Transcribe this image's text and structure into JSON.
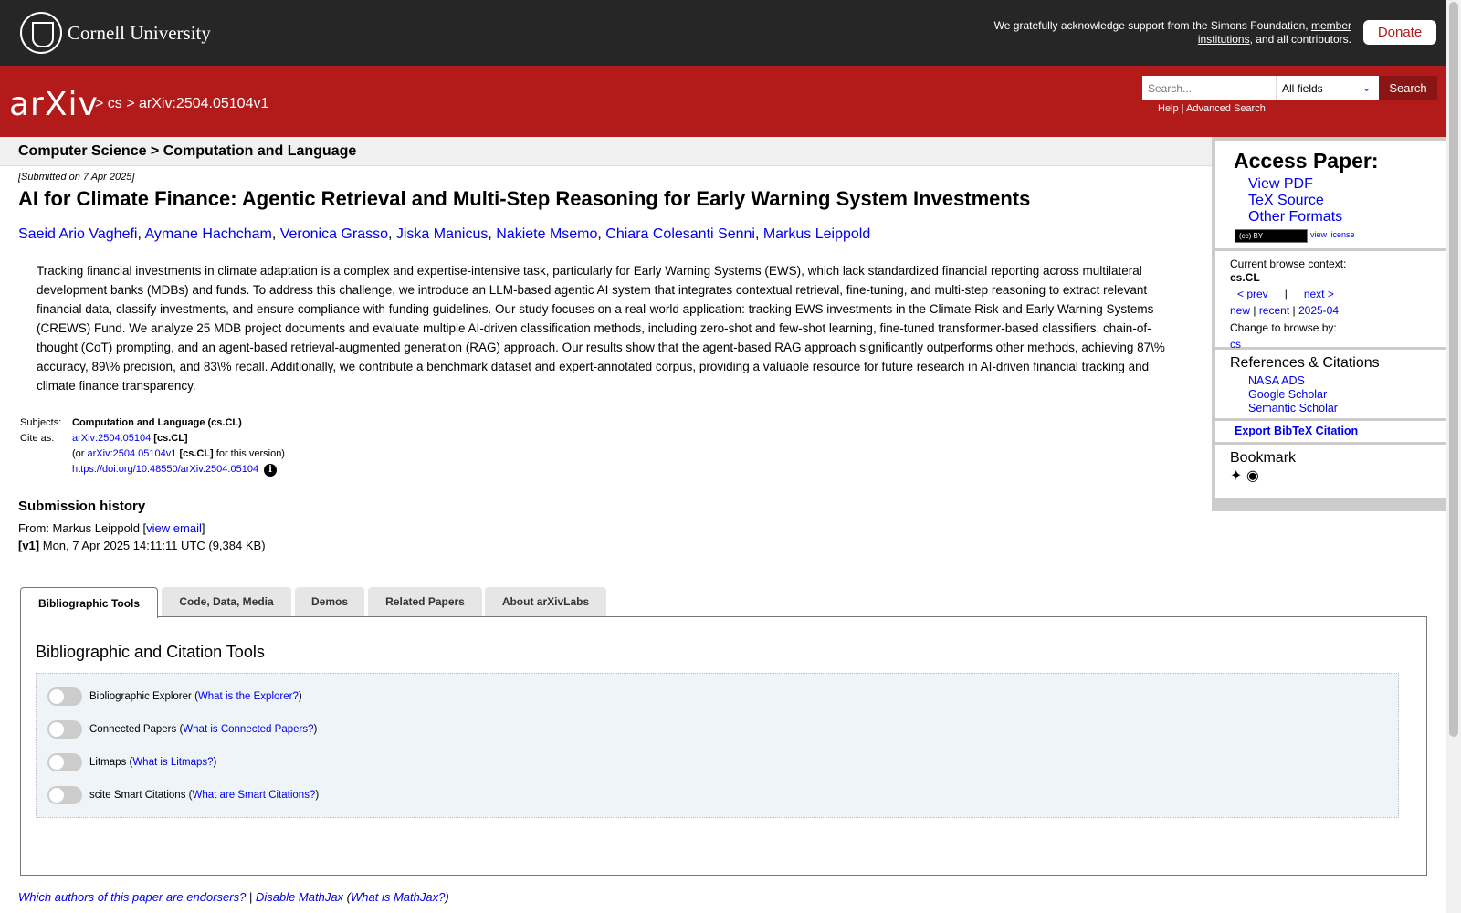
{
  "topbar": {
    "university": "Cornell University",
    "ack_line1": "We gratefully acknowledge support from the Simons Foundation,",
    "ack_link1": "member",
    "ack_link2": "institutions",
    "ack_tail": ", and all contributors.",
    "donate": "Donate"
  },
  "header": {
    "logo": "arXiv",
    "crumb_cs": "cs",
    "crumb_id": "arXiv:2504.05104v1",
    "search_placeholder": "Search...",
    "field_selected": "All fields",
    "search_button": "Search",
    "help": "Help",
    "advanced": "Advanced Search"
  },
  "subhead": "Computer Science > Computation and Language",
  "paper": {
    "submitted": "[Submitted on 7 Apr 2025]",
    "title": "AI for Climate Finance: Agentic Retrieval and Multi-Step Reasoning for Early Warning System Investments",
    "authors": [
      "Saeid Ario Vaghefi",
      "Aymane Hachcham",
      "Veronica Grasso",
      "Jiska Manicus",
      "Nakiete Msemo",
      "Chiara Colesanti Senni",
      "Markus Leippold"
    ],
    "abstract": "Tracking financial investments in climate adaptation is a complex and expertise-intensive task, particularly for Early Warning Systems (EWS), which lack standardized financial reporting across multilateral development banks (MDBs) and funds. To address this challenge, we introduce an LLM-based agentic AI system that integrates contextual retrieval, fine-tuning, and multi-step reasoning to extract relevant financial data, classify investments, and ensure compliance with funding guidelines. Our study focuses on a real-world application: tracking EWS investments in the Climate Risk and Early Warning Systems (CREWS) Fund. We analyze 25 MDB project documents and evaluate multiple AI-driven classification methods, including zero-shot and few-shot learning, fine-tuned transformer-based classifiers, chain-of-thought (CoT) prompting, and an agent-based retrieval-augmented generation (RAG) approach. Our results show that the agent-based RAG approach significantly outperforms other methods, achieving 87\\% accuracy, 89\\% precision, and 83\\% recall. Additionally, we contribute a benchmark dataset and expert-annotated corpus, providing a valuable resource for future research in AI-driven financial tracking and climate finance transparency.",
    "subjects_label": "Subjects:",
    "subjects": "Computation and Language (cs.CL)",
    "cite_label": "Cite as:",
    "cite_id": "arXiv:2504.05104",
    "cite_tag": "[cs.CL]",
    "cite_or": "(or",
    "cite_version": "arXiv:2504.05104v1",
    "cite_tag2": "[cs.CL]",
    "cite_for": "for this version)",
    "doi": "https://doi.org/10.48550/arXiv.2504.05104",
    "history_heading": "Submission history",
    "from_label": "From: Markus Leippold [",
    "view_email": "view email",
    "from_close": "]",
    "v1_label": "[v1]",
    "v1_text": "Mon, 7 Apr 2025 14:11:11 UTC (9,384 KB)"
  },
  "sidebar": {
    "access_heading": "Access Paper:",
    "links": [
      "View PDF",
      "TeX Source",
      "Other Formats"
    ],
    "cc": "(cc) BY",
    "view_license": "view license",
    "context_label": "Current browse context:",
    "context": "cs.CL",
    "prev": "< prev",
    "sep": "|",
    "next": "next >",
    "new": "new",
    "recent": "recent",
    "month": "2025-04",
    "change_label": "Change to browse by:",
    "change_cs": "cs",
    "refs_heading": "References & Citations",
    "refs": [
      "NASA ADS",
      "Google Scholar",
      "Semantic Scholar"
    ],
    "export": "Export BibTeX Citation",
    "bookmark": "Bookmark"
  },
  "tabs": [
    "Bibliographic Tools",
    "Code, Data, Media",
    "Demos",
    "Related Papers",
    "About arXivLabs"
  ],
  "tools": {
    "heading": "Bibliographic and Citation Tools",
    "items": [
      {
        "label": "Bibliographic Explorer",
        "link": "What is the Explorer?"
      },
      {
        "label": "Connected Papers",
        "link": "What is Connected Papers?"
      },
      {
        "label": "Litmaps",
        "link": "What is Litmaps?"
      },
      {
        "label": "scite Smart Citations",
        "link": "What are Smart Citations?"
      }
    ]
  },
  "footer": {
    "endorsers": "Which authors of this paper are endorsers?",
    "sep": "|",
    "mathjax": "Disable MathJax",
    "what_mathjax": "What is MathJax?"
  },
  "colors": {
    "arxiv_red": "#b31b1b",
    "topbar": "#262626",
    "link": "#0000ee"
  }
}
